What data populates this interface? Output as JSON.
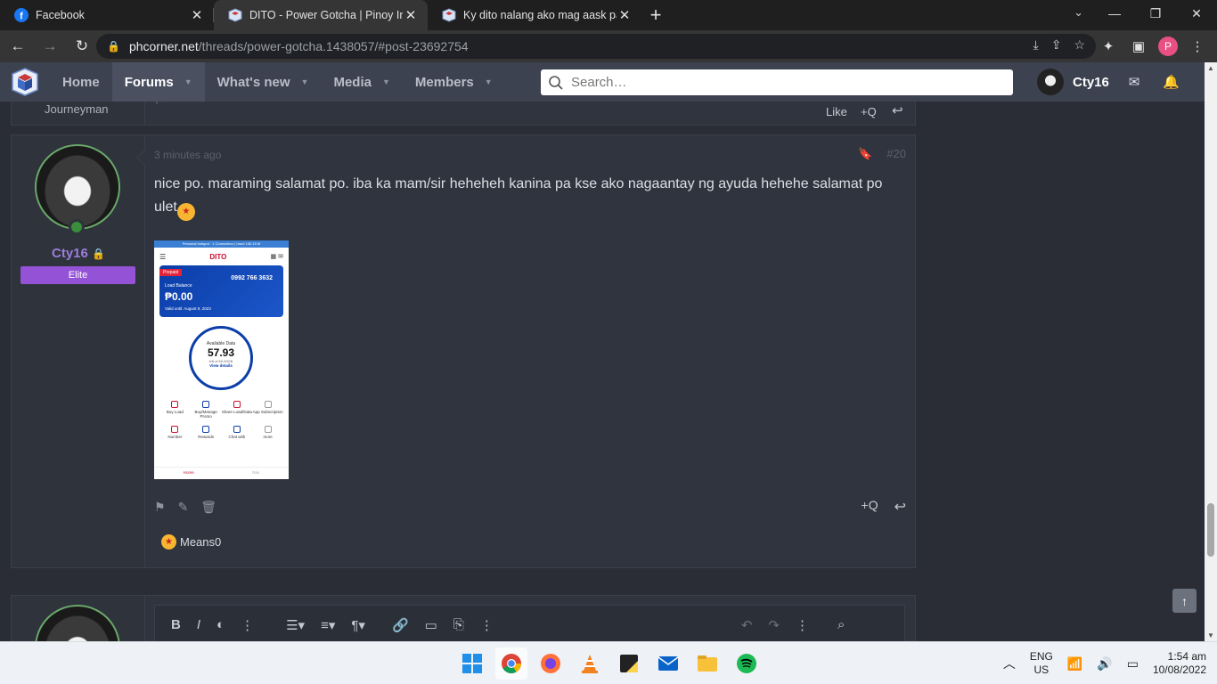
{
  "browser": {
    "tabs": [
      {
        "title": "Facebook",
        "icon": "facebook-icon",
        "active": false
      },
      {
        "title": "DITO - Power Gotcha | Pinoy Inte",
        "icon": "phcorner-icon",
        "active": true
      },
      {
        "title": "Ky dito nalang ako mag aask pan",
        "icon": "phcorner-icon",
        "active": false
      }
    ],
    "url_host": "phcorner.net",
    "url_path": "/threads/power-gotcha.1438057/#post-23692754",
    "profile_initial": "P"
  },
  "site": {
    "nav": [
      {
        "label": "Home",
        "active": false
      },
      {
        "label": "Forums",
        "active": true
      },
      {
        "label": "What's new",
        "active": false
      },
      {
        "label": "Media",
        "active": false
      },
      {
        "label": "Members",
        "active": false
      }
    ],
    "search_placeholder": "Search…",
    "username": "Cty16"
  },
  "prev_post": {
    "rank": "Journeyman",
    "like_label": "Like",
    "quote_label": "+Q"
  },
  "post": {
    "time": "3 minutes ago",
    "number": "#20",
    "author": "Cty16",
    "author_banner": "Elite",
    "text": "nice po. maraming salamat po. iba ka mam/sir heheheh kanina pa kse ako nagaantay ng ayuda hehehe salamat po ulet",
    "quote_label": "+Q",
    "reaction_label": "Means0"
  },
  "attachment": {
    "status_bar": "Personal hotspot · 1 Connection | Used 130.15 M",
    "brand": "DITO",
    "badge": "Prepaid",
    "phone": "0992 766 3632",
    "load_label": "Load Balance",
    "balance": "₱0.00",
    "valid": "Valid until: August 9, 2023",
    "data_label": "Available Data",
    "data_value": "57.93",
    "data_left": "left of 60.00GB",
    "view_details": "View details",
    "menu": [
      "Buy Load",
      "Buy/Manage Promo",
      "Share Load/Data",
      "App Subscription",
      "Number",
      "Rewards",
      "Chat with",
      "more"
    ],
    "bottom_nav": [
      "Home",
      "Nav"
    ]
  },
  "taskbar": {
    "lang_top": "ENG",
    "lang_bottom": "US",
    "time": "1:54 am",
    "date": "10/08/2022"
  },
  "colors": {
    "accent_purple": "#9453d6",
    "username_purple": "#9b7ddb",
    "nav_bg": "#3d4250",
    "page_bg": "#2a2d35"
  }
}
